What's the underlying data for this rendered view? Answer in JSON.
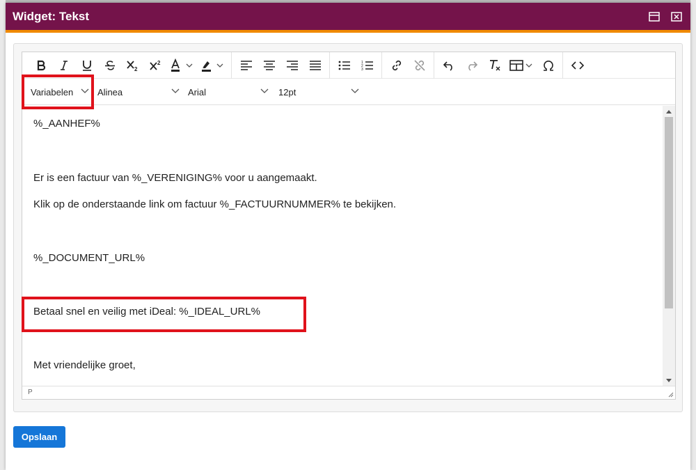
{
  "window": {
    "title": "Widget: Tekst"
  },
  "toolbar": {
    "buttons": [
      "bold-icon",
      "italic-icon",
      "underline-icon",
      "strikethrough-icon",
      "subscript-icon",
      "superscript-icon",
      "text-color-icon",
      "highlight-icon",
      "align-left-icon",
      "align-center-icon",
      "align-right-icon",
      "justify-icon",
      "bullet-list-icon",
      "numbered-list-icon",
      "link-icon",
      "unlink-icon",
      "undo-icon",
      "redo-icon",
      "clear-format-icon",
      "table-icon",
      "omega-icon",
      "source-code-icon"
    ]
  },
  "toolbar2": {
    "variables": "Variabelen",
    "block": "Alinea",
    "font": "Arial",
    "size": "12pt"
  },
  "content": {
    "lines": [
      "%_AANHEF%",
      "Er is een factuur  van %_VERENIGING% voor u aangemaakt.",
      "Klik op de onderstaande link om factuur %_FACTUURNUMMER% te bekijken.",
      "%_DOCUMENT_URL%",
      "Betaal snel en veilig met iDeal: %_IDEAL_URL%",
      "Met vriendelijke groet,"
    ]
  },
  "statusbar": {
    "path": "P"
  },
  "actions": {
    "save_label": "Opslaan"
  },
  "colors": {
    "titlebar": "#74134a",
    "accent": "#f08a00",
    "primary_button": "#1576d8",
    "highlight": "#e0121b"
  }
}
